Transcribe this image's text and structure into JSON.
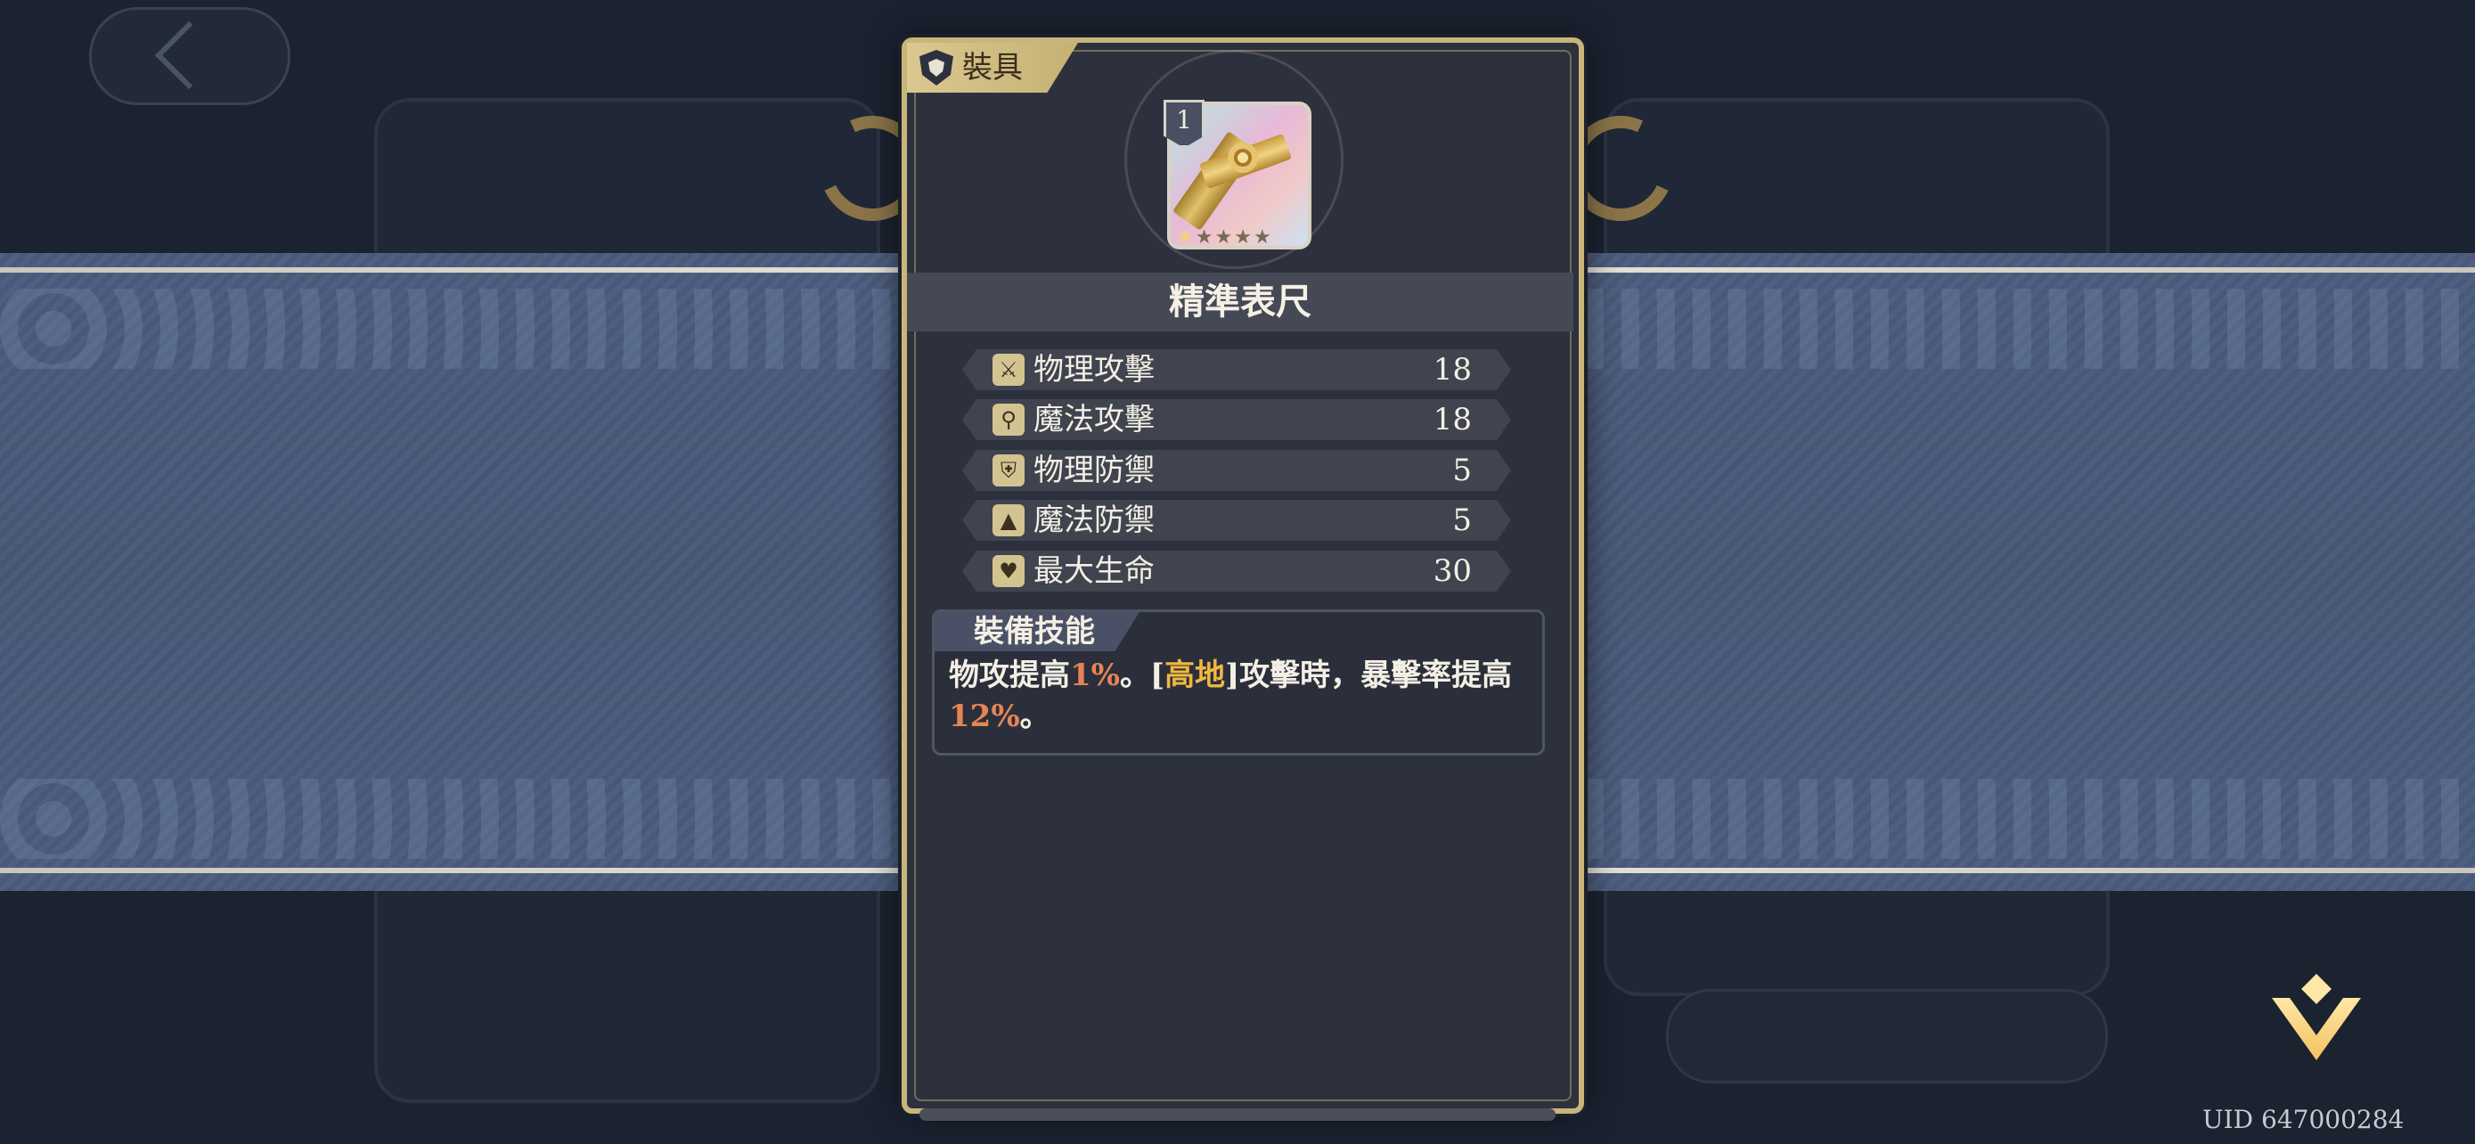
{
  "tag": {
    "label": "裝具",
    "icon": "shield-icon"
  },
  "item": {
    "name": "精準表尺",
    "level": "1",
    "stars_filled": 1,
    "stars_total": 5
  },
  "stats": [
    {
      "icon": "sword-icon",
      "glyph": "⚔",
      "label": "物理攻擊",
      "value": "18"
    },
    {
      "icon": "staff-icon",
      "glyph": "⚲",
      "label": "魔法攻擊",
      "value": "18"
    },
    {
      "icon": "shield-icon",
      "glyph": "⛨",
      "label": "物理防禦",
      "value": "5"
    },
    {
      "icon": "wizard-hat-icon",
      "glyph": "▲",
      "label": "魔法防禦",
      "value": "5"
    },
    {
      "icon": "heart-icon",
      "glyph": "♥",
      "label": "最大生命",
      "value": "30"
    }
  ],
  "skill": {
    "title": "裝備技能",
    "p1": "物攻提高",
    "v1": "1%",
    "p2": "。[",
    "kw": "高地",
    "p3": "]攻擊時，暴擊率提高",
    "v2": "12%",
    "p4": "。"
  },
  "uid": "UID 647000284",
  "colors": {
    "frame_gold": "#c9b57a",
    "panel_bg": "#2d313e",
    "banner_blue": "#4a5b7c",
    "highlight_red": "#e58556",
    "highlight_gold": "#f0b840"
  }
}
